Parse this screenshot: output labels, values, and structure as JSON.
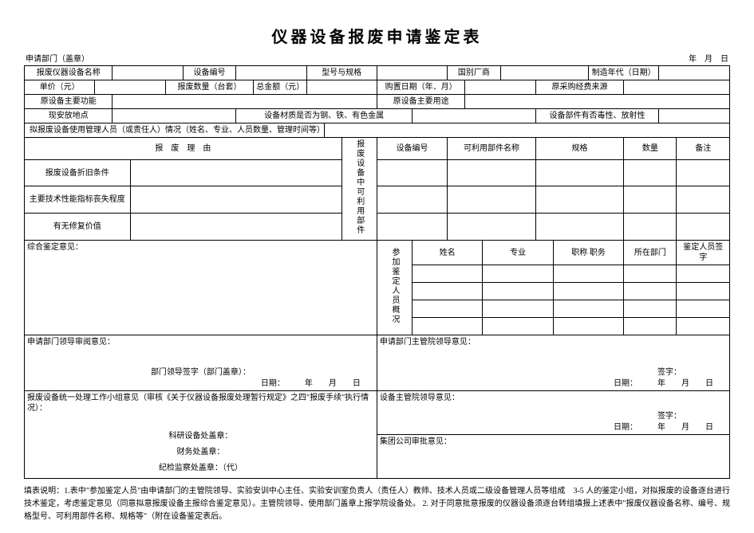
{
  "title": "仪器设备报废申请鉴定表",
  "preline": {
    "left": "申请部门（盖章）",
    "right": "年　月　日"
  },
  "r1": {
    "name": "报废仪器设备名称",
    "code": "设备编号",
    "model": "型号与规格",
    "mfr": "国别厂商",
    "year": "制造年代（日期）"
  },
  "r2": {
    "price": "单价（元）",
    "qty": "报废数量（台套）",
    "total": "总金额（元）",
    "buydate": "购置日期（年．月）",
    "source": "原采购经费来源"
  },
  "r3": {
    "func": "原设备主要功能",
    "use": "原设备主要用途"
  },
  "r4": {
    "loc": "现安放地点",
    "metal": "设备材质是否为钢、铁、有色金属",
    "parts": "设备部件有否毒性、放射性"
  },
  "r5": {
    "mgr": "拟报废设备使用管理人员（或责任人）情况（姓名、专业、人员数量、管理时间等）"
  },
  "reason_hdr": "报　废　理　由",
  "reuse_hdr": "报废设备中可利用部件",
  "reuse_cols": {
    "code": "设备编号",
    "name": "可利用部件名称",
    "spec": "规格",
    "qty": "数量",
    "note": "备注"
  },
  "reason_rows": {
    "cond": "报废设备折旧条件",
    "tech": "主要技术性能指标丧失程度",
    "repair": "有无修复价值"
  },
  "review": {
    "comprehensive": "综合鉴定意见：",
    "participants_hdr": "参加鉴定人员概况",
    "pcols": {
      "name": "姓名",
      "major": "专业",
      "title": "职称 职务",
      "dept": "所在部门",
      "sign": "鉴定人员签字"
    }
  },
  "r_dept": {
    "label": "申请部门领导审阅意见：",
    "sign": "部门领导签字（部门盖章）：",
    "date": "日期：　　　年　　月　　日"
  },
  "r_mgmt": {
    "label": "申请部门主管院领导意见：",
    "sign": "签字：",
    "date": "日期：　　　年　　月　　日"
  },
  "r_group": {
    "label": "报废设备统一处理工作小组意见（审核《关于仪器设备报废处理暂行规定》之四\"报废手续\"执行情况）：",
    "l1": "科研设备处盖章：",
    "l2": "财务处盖章：",
    "l3": "纪检监察处盖章：（代）"
  },
  "r_equip": {
    "label": "设备主管院领导意见：",
    "sign": "签字：",
    "date": "日期：　　　年　　月　　日"
  },
  "r_corp": {
    "label": "集团公司审批意见："
  },
  "instructions": "填表说明：1.表中\"参加鉴定人员\"由申请部门的主管院领导、实验安训中心主任、实验安训室负责人（责任人）教师、技术人员或二级设备管理人员等组成　3-5 人的鉴定小组，对拟报废的设备逐台进行技术鉴定，考虑鉴定意见（同意拟意报废设备主报综合鉴定意见）。主管院领导、使用部门盖章上报学院设备处。 2. 对于同意批意报废的仪器设备须逐台转组填报上述表中\"报废仪器设备名称、编号、规格型号、可利用部件名称、规格等\"（附在设备鉴定表后。"
}
